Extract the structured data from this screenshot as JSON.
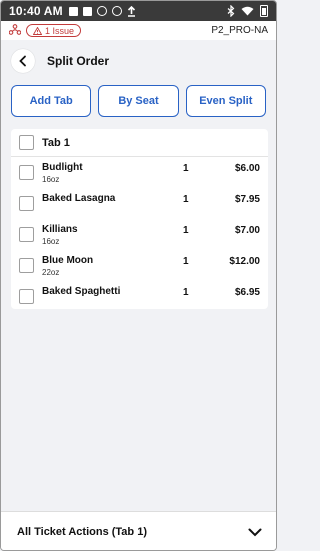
{
  "status_bar": {
    "time": "10:40 AM"
  },
  "topbar": {
    "issue_count": "1 Issue",
    "device_name": "P2_PRO-NA"
  },
  "header": {
    "title": "Split Order"
  },
  "actions": {
    "add_tab": "Add Tab",
    "by_seat": "By Seat",
    "even_split": "Even Split"
  },
  "tab": {
    "label": "Tab 1",
    "items": [
      {
        "name": "Budlight",
        "modifier": "16oz",
        "qty": "1",
        "price": "$6.00"
      },
      {
        "name": "Baked Lasagna",
        "modifier": "",
        "qty": "1",
        "price": "$7.95"
      },
      {
        "name": "Killians",
        "modifier": "16oz",
        "qty": "1",
        "price": "$7.00"
      },
      {
        "name": "Blue Moon",
        "modifier": "22oz",
        "qty": "1",
        "price": "$12.00"
      },
      {
        "name": "Baked Spaghetti",
        "modifier": "",
        "qty": "1",
        "price": "$6.95"
      }
    ]
  },
  "footer": {
    "label": "All Ticket Actions (Tab 1)"
  },
  "colors": {
    "accent": "#2962c5",
    "issue": "#c23b3b",
    "status_bar": "#3a3a3a",
    "background": "#f1f2f5"
  }
}
